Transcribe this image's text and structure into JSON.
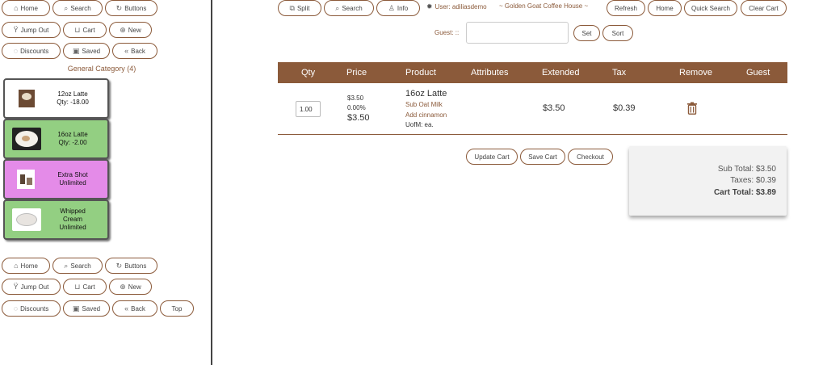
{
  "nav": {
    "home": "Home",
    "search": "Search",
    "buttons": "Buttons",
    "jump_out": "Jump Out",
    "cart": "Cart",
    "new": "New",
    "discounts": "Discounts",
    "saved": "Saved",
    "back": "Back",
    "top": "Top"
  },
  "category_title": "General Category (4)",
  "products": [
    {
      "name": "12oz Latte",
      "qty": "Qty: -18.00",
      "bg": "#ffffff"
    },
    {
      "name": "16oz Latte",
      "qty": "Qty: -2.00",
      "bg": "#93cf82"
    },
    {
      "name": "Extra Shot",
      "qty": "Unlimited",
      "bg": "#e48be8"
    },
    {
      "name": "Whipped Cream",
      "qty": "Unlimited",
      "bg": "#93cf82"
    }
  ],
  "topbar": {
    "split": "Split",
    "search": "Search",
    "info": "Info",
    "user": "User: adiliasdemo",
    "store": "~ Golden Goat Coffee House ~",
    "refresh": "Refresh",
    "home": "Home",
    "quick_search": "Quick Search",
    "clear_cart": "Clear Cart",
    "guest_label": "Guest: ::",
    "guest_value": "",
    "set": "Set",
    "sort": "Sort"
  },
  "table": {
    "headers": [
      "Qty",
      "Price",
      "Product",
      "Attributes",
      "Extended",
      "Tax",
      "Remove",
      "Guest"
    ],
    "rows": [
      {
        "qty": "1.00",
        "price": "$3.50",
        "discount": "0.00%",
        "net_price": "$3.50",
        "product": "16oz Latte",
        "mods": [
          "Sub Oat Milk",
          "Add cinnamon"
        ],
        "uofm": "UofM: ea.",
        "extended": "$3.50",
        "tax": "$0.39"
      }
    ]
  },
  "actions": {
    "update_cart": "Update Cart",
    "save_cart": "Save Cart",
    "checkout": "Checkout"
  },
  "totals": {
    "sub_total": "Sub Total: $3.50",
    "taxes": "Taxes: $0.39",
    "cart_total": "Cart Total: $3.89"
  },
  "colors": {
    "accent": "#8b5a3a",
    "tile_green": "#93cf82",
    "tile_pink": "#e48be8"
  }
}
